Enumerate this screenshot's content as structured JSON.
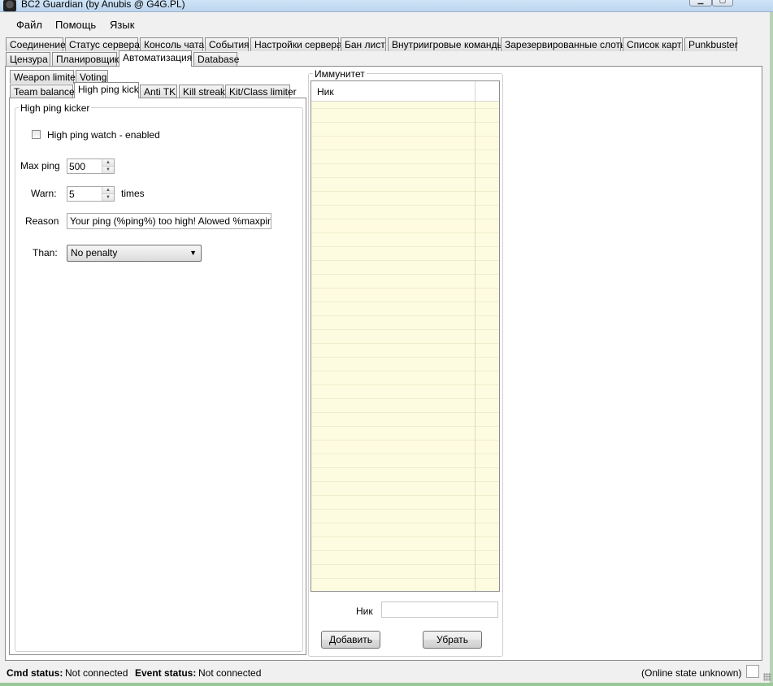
{
  "window": {
    "title": "BC2 Guardian (by Anubis @ G4G.PL)"
  },
  "menu": [
    "Файл",
    "Помощь",
    "Язык"
  ],
  "main_tabs_row1": [
    "Соединение",
    "Статус сервера",
    "Консоль чата",
    "События",
    "Настройки сервера",
    "Бан лист",
    "Внутриигровые команды",
    "Зарезервированные слоты",
    "Список карт",
    "Punkbuster"
  ],
  "main_tabs_row2": [
    "Цензура",
    "Планировщик",
    "Автоматизация",
    "Database"
  ],
  "active_main_tab": "Автоматизация",
  "sub_tabs_row1": [
    "Weapon limiter",
    "Voting"
  ],
  "sub_tabs_row2": [
    "Team balance",
    "High ping kick",
    "Anti TK",
    "Kill streak",
    "Kit/Class limiter"
  ],
  "active_sub_tab": "High ping kick",
  "high_ping": {
    "group_title": "High ping kicker",
    "enable_label": "High ping watch - enabled",
    "enabled": false,
    "max_ping_label": "Max ping",
    "max_ping_value": "500",
    "warn_label": "Warn:",
    "warn_value": "5",
    "warn_suffix": "times",
    "reason_label": "Reason",
    "reason_value": "Your ping (%ping%) too high! Alowed %maxping%",
    "than_label": "Than:",
    "than_value": "No penalty"
  },
  "immunity": {
    "group_title": "Иммунитет",
    "column_header": "Ник",
    "nick_label": "Ник",
    "nick_value": "",
    "add_button": "Добавить",
    "remove_button": "Убрать"
  },
  "status": {
    "cmd_label": "Cmd status:",
    "cmd_value": "Not connected",
    "event_label": "Event status:",
    "event_value": "Not connected",
    "online_state": "(Online state unknown)"
  },
  "colors": {
    "list_background": "#fefce0",
    "window_frame": "#9ac899"
  }
}
